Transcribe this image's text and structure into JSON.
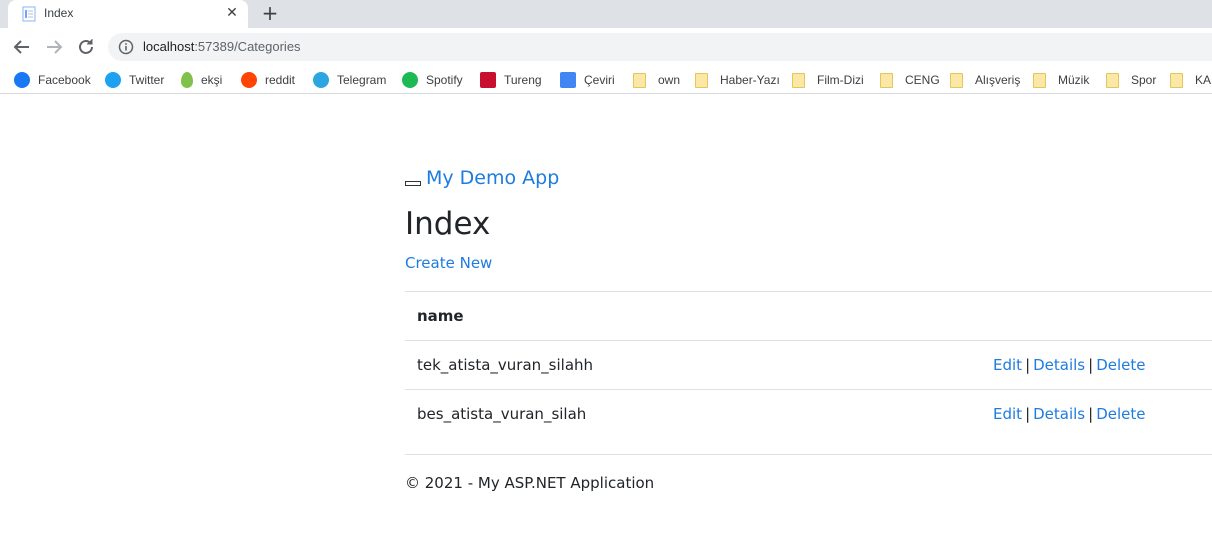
{
  "browser": {
    "tab_title": "Index",
    "url_host": "localhost",
    "url_rest": ":57389/Categories",
    "bookmarks": [
      {
        "label": "Facebook",
        "icon": "facebook-icon",
        "color": "#1877f2"
      },
      {
        "label": "Twitter",
        "icon": "twitter-icon",
        "color": "#1da1f2"
      },
      {
        "label": "ekşi",
        "icon": "eksi-icon",
        "color": "#81c14b"
      },
      {
        "label": "reddit",
        "icon": "reddit-icon",
        "color": "#ff4500"
      },
      {
        "label": "Telegram",
        "icon": "telegram-icon",
        "color": "#2ca5e0"
      },
      {
        "label": "Spotify",
        "icon": "spotify-icon",
        "color": "#1db954"
      },
      {
        "label": "Tureng",
        "icon": "tureng-icon",
        "color": "#c8102e"
      },
      {
        "label": "Çeviri",
        "icon": "translate-icon",
        "color": "#4285f4"
      },
      {
        "label": "own",
        "icon": "folder-icon"
      },
      {
        "label": "Haber-Yazı",
        "icon": "folder-icon"
      },
      {
        "label": "Film-Dizi",
        "icon": "folder-icon"
      },
      {
        "label": "CENG",
        "icon": "folder-icon"
      },
      {
        "label": "Alışveriş",
        "icon": "folder-icon"
      },
      {
        "label": "Müzik",
        "icon": "folder-icon"
      },
      {
        "label": "Spor",
        "icon": "folder-icon"
      },
      {
        "label": "KAL",
        "icon": "folder-icon"
      }
    ]
  },
  "app": {
    "brand": "My Demo App",
    "title": "Index",
    "create_new": "Create New",
    "table": {
      "header": "name",
      "rows": [
        {
          "name": "tek_atista_vuran_silahh",
          "edit": "Edit",
          "details": "Details",
          "delete": "Delete"
        },
        {
          "name": "bes_atista_vuran_silah",
          "edit": "Edit",
          "details": "Details",
          "delete": "Delete"
        }
      ]
    },
    "footer": "© 2021 - My ASP.NET Application"
  },
  "colors": {
    "link": "#1e7be0",
    "text": "#212529",
    "border": "#dee2e6"
  }
}
